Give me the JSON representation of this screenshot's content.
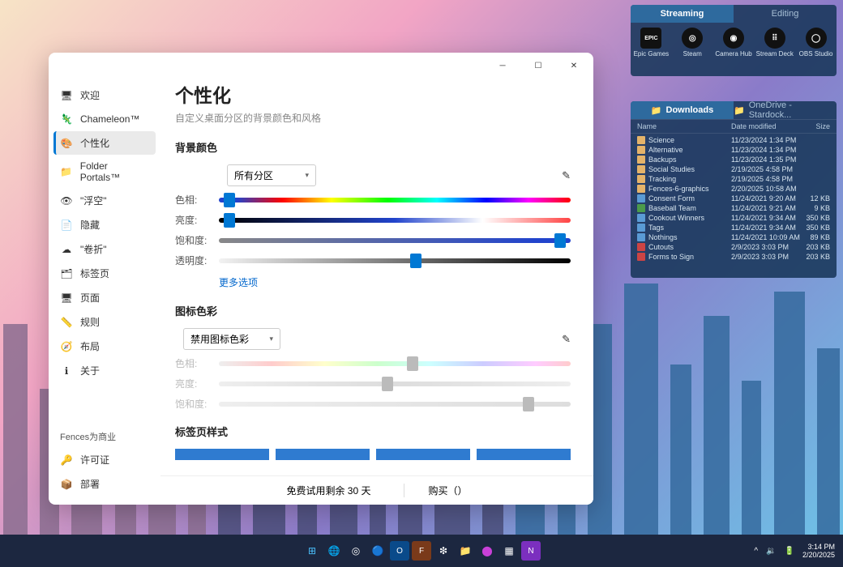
{
  "window": {
    "title": "个性化",
    "subtitle": "自定义桌面分区的背景颜色和风格",
    "sidebar": {
      "items": [
        {
          "icon_name": "welcome-icon",
          "label": "欢迎"
        },
        {
          "icon_name": "chameleon-icon",
          "label": "Chameleon™"
        },
        {
          "icon_name": "personalize-icon",
          "label": "个性化"
        },
        {
          "icon_name": "folder-icon",
          "label": "Folder Portals™"
        },
        {
          "icon_name": "float-icon",
          "label": "\"浮空\""
        },
        {
          "icon_name": "hide-icon",
          "label": "隐藏"
        },
        {
          "icon_name": "rollup-icon",
          "label": "\"卷折\""
        },
        {
          "icon_name": "tabs-icon",
          "label": "标签页"
        },
        {
          "icon_name": "page-icon",
          "label": "页面"
        },
        {
          "icon_name": "rules-icon",
          "label": "规则"
        },
        {
          "icon_name": "layout-icon",
          "label": "布局"
        },
        {
          "icon_name": "about-icon",
          "label": "关于"
        }
      ],
      "business_title": "Fences为商业",
      "business_items": [
        {
          "icon_name": "license-icon",
          "label": "许可证"
        },
        {
          "icon_name": "deploy-icon",
          "label": "部署"
        }
      ]
    },
    "sections": {
      "bg_color": {
        "heading": "背景颜色",
        "dropdown": "所有分区",
        "hue": "色相:",
        "brightness": "亮度:",
        "saturation": "饱和度:",
        "transparency": "透明度:",
        "more": "更多选项"
      },
      "icon_tint": {
        "heading": "图标色彩",
        "dropdown": "禁用图标色彩",
        "hue": "色相:",
        "brightness": "亮度:",
        "saturation": "饱和度:"
      },
      "tab_style": {
        "heading": "标签页样式"
      }
    },
    "footer": {
      "trial": "免费试用剩余 30 天",
      "buy": "购买（）"
    }
  },
  "streaming_fence": {
    "tabs": [
      "Streaming",
      "Editing"
    ],
    "apps": [
      {
        "label": "Epic Games"
      },
      {
        "label": "Steam"
      },
      {
        "label": "Camera Hub"
      },
      {
        "label": "Stream Deck"
      },
      {
        "label": "OBS Studio"
      }
    ]
  },
  "downloads_fence": {
    "tabs": [
      "Downloads",
      "OneDrive - Stardock..."
    ],
    "columns": {
      "name": "Name",
      "date": "Date modified",
      "size": "Size"
    },
    "rows": [
      {
        "type": "folder",
        "name": "Science",
        "date": "11/23/2024 1:34 PM",
        "size": ""
      },
      {
        "type": "folder",
        "name": "Alternative",
        "date": "11/23/2024 1:34 PM",
        "size": ""
      },
      {
        "type": "folder",
        "name": "Backups",
        "date": "11/23/2024 1:35 PM",
        "size": ""
      },
      {
        "type": "folder",
        "name": "Social Studies",
        "date": "2/19/2025 4:58 PM",
        "size": ""
      },
      {
        "type": "folder",
        "name": "Tracking",
        "date": "2/19/2025 4:58 PM",
        "size": ""
      },
      {
        "type": "folder",
        "name": "Fences-6-graphics",
        "date": "2/20/2025 10:58 AM",
        "size": ""
      },
      {
        "type": "doc",
        "name": "Consent Form",
        "date": "11/24/2021 9:20 AM",
        "size": "12 KB"
      },
      {
        "type": "xls",
        "name": "Baseball Team",
        "date": "11/24/2021 9:21 AM",
        "size": "9 KB"
      },
      {
        "type": "doc",
        "name": "Cookout Winners",
        "date": "11/24/2021 9:34 AM",
        "size": "350 KB"
      },
      {
        "type": "doc",
        "name": "Tags",
        "date": "11/24/2021 9:34 AM",
        "size": "350 KB"
      },
      {
        "type": "doc",
        "name": "Nothings",
        "date": "11/24/2021 10:09 AM",
        "size": "89 KB"
      },
      {
        "type": "pdf",
        "name": "Cutouts",
        "date": "2/9/2023 3:03 PM",
        "size": "203 KB"
      },
      {
        "type": "pdf",
        "name": "Forms to Sign",
        "date": "2/9/2023 3:03 PM",
        "size": "203 KB"
      }
    ]
  },
  "taskbar": {
    "time": "3:14 PM",
    "date": "2/20/2025"
  }
}
